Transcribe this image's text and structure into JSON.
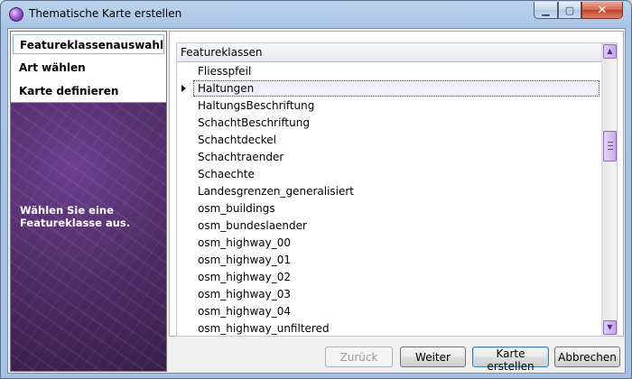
{
  "window": {
    "title": "Thematische Karte erstellen",
    "caption_buttons": {
      "minimize": "▁",
      "maximize": "▢",
      "close": "✕"
    }
  },
  "nav": {
    "items": [
      {
        "label": "Featureklassenauswahl",
        "active": true
      },
      {
        "label": "Art wählen",
        "active": false
      },
      {
        "label": "Karte definieren",
        "active": false
      }
    ],
    "hint": "Wählen Sie eine Featureklasse aus."
  },
  "list": {
    "header": "Featureklassen",
    "rows": [
      "Fliesspfeil",
      "Haltungen",
      "HaltungsBeschriftung",
      "SchachtBeschriftung",
      "Schachtdeckel",
      "Schachtraender",
      "Schaechte",
      "Landesgrenzen_generalisiert",
      "osm_buildings",
      "osm_bundeslaender",
      "osm_highway_00",
      "osm_highway_01",
      "osm_highway_02",
      "osm_highway_03",
      "osm_highway_04",
      "osm_highway_unfiltered"
    ],
    "selected_index": 1
  },
  "buttons": {
    "back": {
      "label": "Zurück",
      "enabled": false
    },
    "next": {
      "label": "Weiter",
      "enabled": true
    },
    "create": {
      "label": "Karte erstellen",
      "enabled": true
    },
    "cancel": {
      "label": "Abbrechen",
      "enabled": true
    }
  },
  "colors": {
    "accent_purple": "#5b2d7a",
    "selection_border": "#444444"
  }
}
